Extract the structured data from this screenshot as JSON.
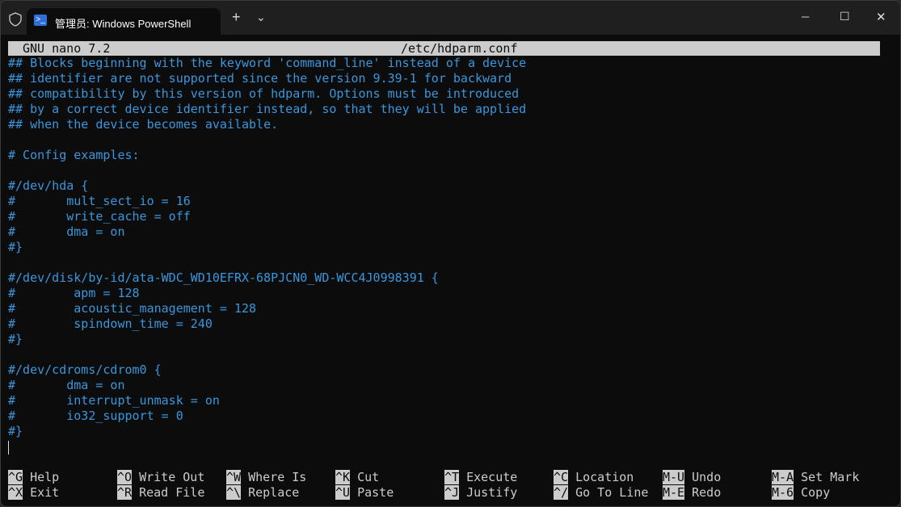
{
  "window": {
    "tab_title": "管理员: Windows PowerShell",
    "new_tab": "+",
    "dropdown": "⌄",
    "minimize": "─",
    "maximize": "☐",
    "close": "✕",
    "tab_close": "✕"
  },
  "nano": {
    "version": "GNU nano 7.2",
    "filename": "/etc/hdparm.conf"
  },
  "lines": [
    "## Blocks beginning with the keyword 'command_line' instead of a device",
    "## identifier are not supported since the version 9.39-1 for backward",
    "## compatibility by this version of hdparm. Options must be introduced",
    "## by a correct device identifier instead, so that they will be applied",
    "## when the device becomes available.",
    "",
    "# Config examples:",
    "",
    "#/dev/hda {",
    "#       mult_sect_io = 16",
    "#       write_cache = off",
    "#       dma = on",
    "#}",
    "",
    "#/dev/disk/by-id/ata-WDC_WD10EFRX-68PJCN0_WD-WCC4J0998391 {",
    "#        apm = 128",
    "#        acoustic_management = 128",
    "#        spindown_time = 240",
    "#}",
    "",
    "#/dev/cdroms/cdrom0 {",
    "#       dma = on",
    "#       interrupt_unmask = on",
    "#       io32_support = 0",
    "#}"
  ],
  "shortcuts": [
    [
      {
        "key": "^G",
        "label": "Help"
      },
      {
        "key": "^X",
        "label": "Exit"
      }
    ],
    [
      {
        "key": "^O",
        "label": "Write Out"
      },
      {
        "key": "^R",
        "label": "Read File"
      }
    ],
    [
      {
        "key": "^W",
        "label": "Where Is"
      },
      {
        "key": "^\\",
        "label": "Replace"
      }
    ],
    [
      {
        "key": "^K",
        "label": "Cut"
      },
      {
        "key": "^U",
        "label": "Paste"
      }
    ],
    [
      {
        "key": "^T",
        "label": "Execute"
      },
      {
        "key": "^J",
        "label": "Justify"
      }
    ],
    [
      {
        "key": "^C",
        "label": "Location"
      },
      {
        "key": "^/",
        "label": "Go To Line"
      }
    ],
    [
      {
        "key": "M-U",
        "label": "Undo"
      },
      {
        "key": "M-E",
        "label": "Redo"
      }
    ],
    [
      {
        "key": "M-A",
        "label": "Set Mark"
      },
      {
        "key": "M-6",
        "label": "Copy"
      }
    ]
  ]
}
